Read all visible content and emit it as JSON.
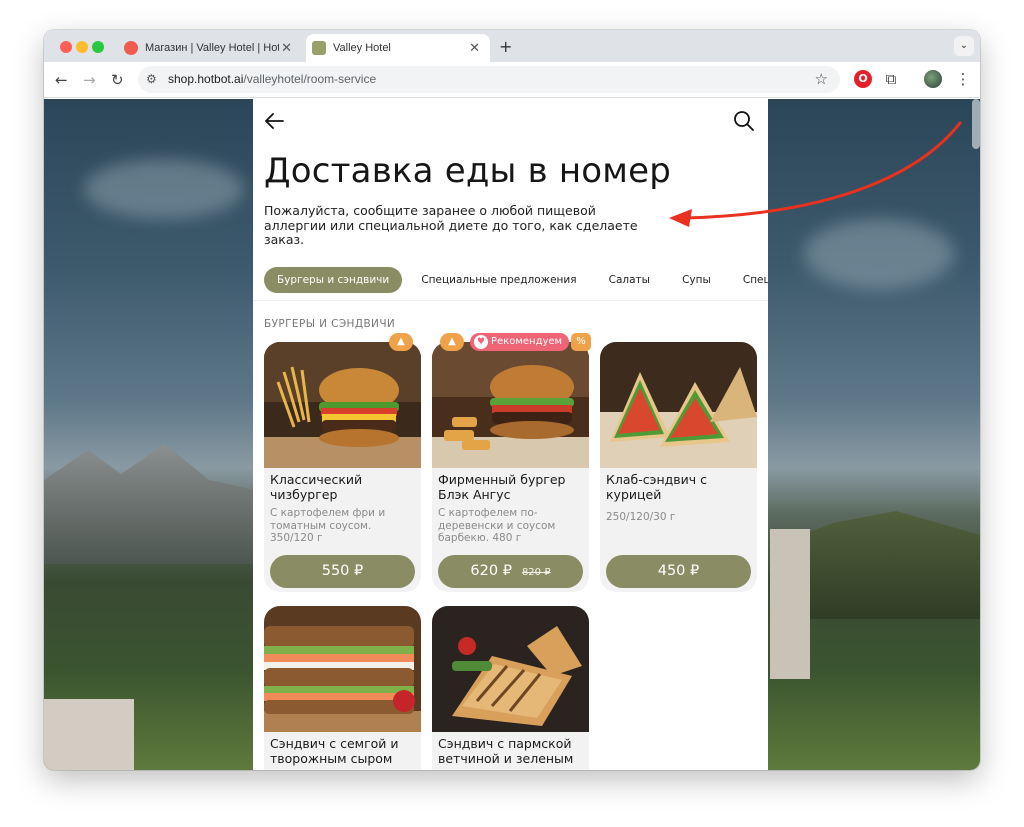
{
  "browser": {
    "tabs": [
      {
        "title": "Магазин | Valley Hotel | Hotbot",
        "close": "✕"
      },
      {
        "title": "Valley Hotel",
        "close": "✕"
      }
    ],
    "new_tab": "+",
    "tab_menu": "⌄",
    "url_host": "shop.hotbot.ai",
    "url_path": "/valleyhotel/room-service",
    "icons": {
      "back": "←",
      "forward": "→",
      "reload": "↻",
      "site_info": "⚙",
      "bookmark": "☆",
      "opera": "O",
      "extensions": "⧉",
      "menu": "⋮"
    }
  },
  "page": {
    "title": "Доставка еды в номер",
    "description": "Пожалуйста, сообщите заранее о любой пищевой аллергии или специальной диете до того, как сделаете заказ.",
    "categories": [
      {
        "label": "Бургеры и сэндвичи",
        "active": true
      },
      {
        "label": "Специальные предложения",
        "active": false
      },
      {
        "label": "Салаты",
        "active": false
      },
      {
        "label": "Супы",
        "active": false
      },
      {
        "label": "Специальные",
        "active": false
      }
    ],
    "section_title": "БУРГЕРЫ И СЭНДВИЧИ",
    "recommend_label": "Рекомендуем",
    "percent_badge": "%",
    "products": [
      {
        "name": "Классический чизбургер",
        "desc": "С картофелем фри и томатным соусом. 350/120 г",
        "price": "550 ₽"
      },
      {
        "name": "Фирменный бургер Блэк Ангус",
        "desc": "С картофелем по-деревенски и соусом барбекю. 480 г",
        "price": "620 ₽",
        "old_price": "820 ₽"
      },
      {
        "name": "Клаб-сэндвич с курицей",
        "weight": "250/120/30 г",
        "price": "450 ₽"
      },
      {
        "name": "Сэндвич с семгой и творожным сыром"
      },
      {
        "name": "Сэндвич с пармской ветчиной и зеленым"
      }
    ]
  },
  "colors": {
    "accent": "#8a8d63",
    "badge_orange": "#f0a24a",
    "badge_pink": "#f06576",
    "annotation_arrow": "#e8311f"
  }
}
